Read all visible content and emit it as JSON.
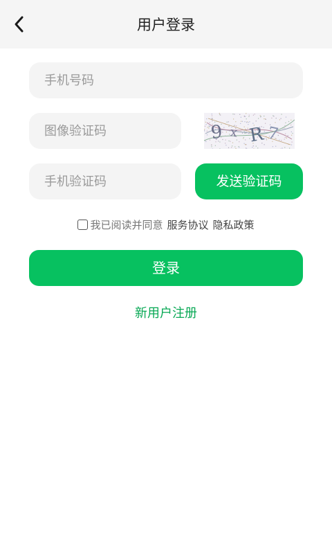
{
  "header": {
    "title": "用户登录",
    "back_icon": "chevron-left-icon"
  },
  "form": {
    "phone_placeholder": "手机号码",
    "captcha_placeholder": "图像验证码",
    "captcha_text": "9 x R 7",
    "sms_placeholder": "手机验证码",
    "send_code_label": "发送验证码"
  },
  "agreement": {
    "text": "我已阅读并同意",
    "service_link": "服务协议",
    "privacy_link": "隐私政策"
  },
  "actions": {
    "login_label": "登录",
    "register_label": "新用户注册"
  },
  "colors": {
    "accent": "#07c160",
    "header_bg": "#f5f5f5",
    "field_bg": "#f4f4f4"
  }
}
